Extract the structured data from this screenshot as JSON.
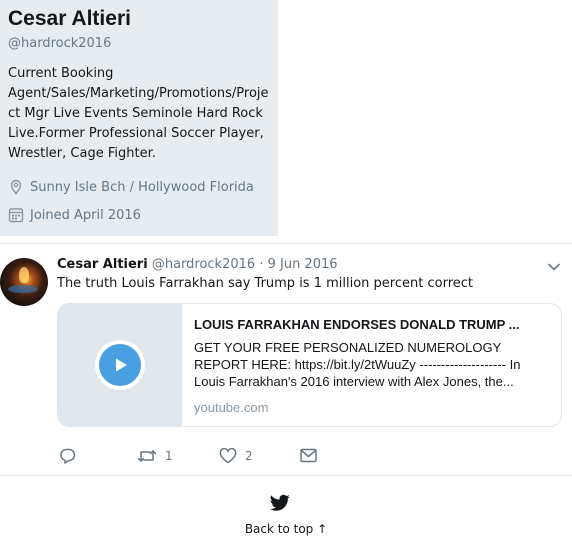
{
  "profile": {
    "name": "Cesar Altieri",
    "handle": "@hardrock2016",
    "bio_lines": [
      "Current Booking",
      "Agent/Sales/Marketing/Promotions/Proje",
      "ct Mgr Live Events Seminole Hard Rock",
      "Live.Former Professional Soccer Player,",
      "Wrestler, Cage Fighter."
    ],
    "location": "Sunny Isle Bch / Hollywood Florida",
    "joined": "Joined April 2016"
  },
  "tweet": {
    "author": "Cesar Altieri",
    "handle": "@hardrock2016",
    "separator": "·",
    "date": "9 Jun 2016",
    "text": "The truth Louis Farrakhan say Trump is 1 million percent correct",
    "card": {
      "title": "LOUIS FARRAKHAN ENDORSES DONALD TRUMP ...",
      "description": "GET YOUR FREE PERSONALIZED NUMEROLOGY REPORT HERE: https://bit.ly/2tWuuZy -------------------- In Louis Farrakhan's 2016 interview with Alex Jones, the...",
      "domain": "youtube.com"
    },
    "actions": {
      "reply_count": "",
      "retweet_count": "1",
      "like_count": "2"
    }
  },
  "footer": {
    "back_to_top": "Back to top ↑"
  },
  "icons": {
    "location": "location-pin-icon",
    "calendar": "calendar-icon",
    "caret": "chevron-down-icon",
    "play": "play-icon",
    "reply": "reply-icon",
    "retweet": "retweet-icon",
    "like": "heart-icon",
    "dm": "envelope-icon",
    "bird": "twitter-bird-icon"
  },
  "colors": {
    "profile_bg": "#e6ecf0",
    "secondary_text": "#657786",
    "play_blue": "#4a9fe0"
  }
}
